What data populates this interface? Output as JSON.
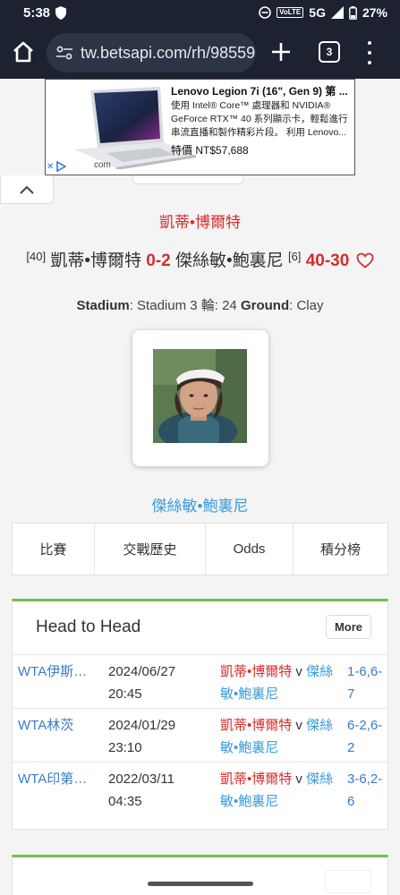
{
  "status_bar": {
    "time": "5:38",
    "network": "5G",
    "volte": "VoLTE",
    "battery": "27%"
  },
  "browser": {
    "url": "tw.betsapi.com/rh/98559",
    "tab_count": "3"
  },
  "ad": {
    "title": "Lenovo Legion 7i (16\", Gen 9) 第 ...",
    "description": "使用 Intel® Core™ 處理器和 NVIDIA® GeForce RTX™ 40 系列顯示卡，輕鬆進行串流直播和製作精彩片段。 利用 Lenovo...",
    "price": "特價 NT$57,688",
    "domain": "com"
  },
  "match": {
    "player1_title": "凱蒂•博爾特",
    "home_rank": "[40]",
    "home_name": "凱蒂•博爾特",
    "sets": "0-2",
    "away_name": "傑絲敏•鮑裏尼",
    "away_rank": "[6]",
    "game_score": "40-30",
    "stadium_label": "Stadium",
    "stadium_value": ": Stadium 3 輪: 24 ",
    "ground_label": "Ground",
    "ground_value": ": Clay",
    "player2_name": "傑絲敏•鮑裏尼"
  },
  "tabs": [
    {
      "label": "比賽"
    },
    {
      "label": "交戰歷史"
    },
    {
      "label": "Odds"
    },
    {
      "label": "積分榜"
    }
  ],
  "h2h": {
    "title": "Head to Head",
    "more_label": "More",
    "rows": [
      {
        "league": "WTA伊斯坦布爾",
        "date": "2024/06/27",
        "time": "20:45",
        "home": "凱蒂•博爾特",
        "vs": " v ",
        "away": "傑絲敏•鮑裏尼",
        "score": "1-6,6-7"
      },
      {
        "league": "WTA林茨",
        "date": "2024/01/29",
        "time": "23:10",
        "home": "凱蒂•博爾特",
        "vs": " v ",
        "away": "傑絲敏•鮑裏尼",
        "score": "6-2,6-2"
      },
      {
        "league": "WTA印第安維爾斯",
        "date": "2022/03/11",
        "time": "04:35",
        "home": "凱蒂•博爾特",
        "vs": " v ",
        "away": "傑絲敏•鮑裏尼",
        "score": "3-6,2-6"
      }
    ]
  },
  "colors": {
    "home_red": "#d62d2d",
    "away_blue": "#3a9ad9",
    "link_blue": "#3a7bc8",
    "card_accent_green": "#6cc24a",
    "browser_bar": "#1c2230"
  }
}
